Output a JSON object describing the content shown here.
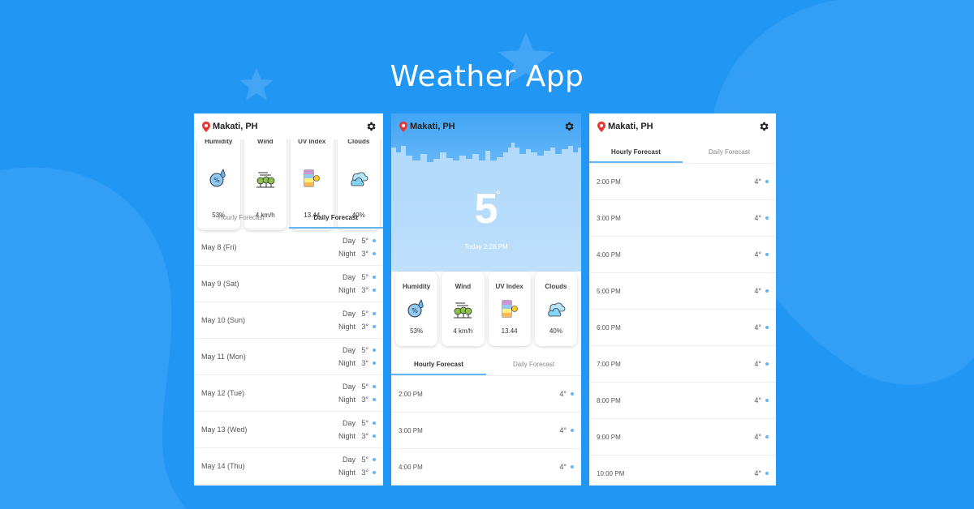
{
  "title": "Weather App",
  "colors": {
    "background": "#2196f3",
    "accent": "#64b5f6",
    "pin": "#e53935"
  },
  "location": "Makati, PH",
  "stats": [
    {
      "label": "Humidity",
      "value": "53%",
      "icon": "humidity-icon"
    },
    {
      "label": "Wind",
      "value": "4 km/h",
      "icon": "wind-icon"
    },
    {
      "label": "UV Index",
      "value": "13.44",
      "icon": "uv-index-icon"
    },
    {
      "label": "Clouds",
      "value": "40%",
      "icon": "clouds-icon"
    }
  ],
  "tabs": {
    "hourly": "Hourly Forecast",
    "daily": "Daily Forecast"
  },
  "current": {
    "temp": "5",
    "degree": "°",
    "date": "Today 2:28 PM"
  },
  "daily": [
    {
      "date": "May 8 (Fri)",
      "day_label": "Day",
      "day_temp": "5°",
      "night_label": "Night",
      "night_temp": "3°"
    },
    {
      "date": "May 9 (Sat)",
      "day_label": "Day",
      "day_temp": "5°",
      "night_label": "Night",
      "night_temp": "3°"
    },
    {
      "date": "May 10 (Sun)",
      "day_label": "Day",
      "day_temp": "5°",
      "night_label": "Night",
      "night_temp": "3°"
    },
    {
      "date": "May 11 (Mon)",
      "day_label": "Day",
      "day_temp": "5°",
      "night_label": "Night",
      "night_temp": "3°"
    },
    {
      "date": "May 12 (Tue)",
      "day_label": "Day",
      "day_temp": "5°",
      "night_label": "Night",
      "night_temp": "3°"
    },
    {
      "date": "May 13 (Wed)",
      "day_label": "Day",
      "day_temp": "5°",
      "night_label": "Night",
      "night_temp": "3°"
    },
    {
      "date": "May 14 (Thu)",
      "day_label": "Day",
      "day_temp": "5°",
      "night_label": "Night",
      "night_temp": "3°"
    }
  ],
  "hourly": [
    {
      "time": "2:00 PM",
      "temp": "4°"
    },
    {
      "time": "3:00 PM",
      "temp": "4°"
    },
    {
      "time": "4:00 PM",
      "temp": "4°"
    },
    {
      "time": "5:00 PM",
      "temp": "4°"
    },
    {
      "time": "6:00 PM",
      "temp": "4°"
    },
    {
      "time": "7:00 PM",
      "temp": "4°"
    },
    {
      "time": "8:00 PM",
      "temp": "4°"
    },
    {
      "time": "9:00 PM",
      "temp": "4°"
    },
    {
      "time": "10:00 PM",
      "temp": "4°"
    }
  ]
}
